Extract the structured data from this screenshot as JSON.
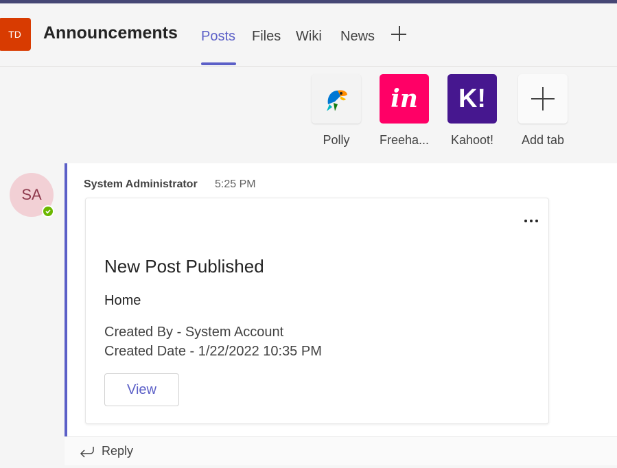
{
  "header": {
    "team_initials": "TD",
    "channel_title": "Announcements",
    "tabs": [
      {
        "label": "Posts"
      },
      {
        "label": "Files"
      },
      {
        "label": "Wiki"
      },
      {
        "label": "News"
      }
    ],
    "active_tab": "Posts"
  },
  "apps": [
    {
      "label": "Polly",
      "icon": "polly-parrot-icon"
    },
    {
      "label": "Freeha...",
      "icon": "invision-freehand-icon",
      "glyph": "in"
    },
    {
      "label": "Kahoot!",
      "icon": "kahoot-icon",
      "glyph": "K!"
    },
    {
      "label": "Add tab",
      "icon": "plus-icon"
    }
  ],
  "message": {
    "author_initials": "SA",
    "author": "System Administrator",
    "time": "5:25 PM",
    "card": {
      "title": "New Post Published",
      "subtitle": "Home",
      "created_by": "Created By - System Account",
      "created_date": "Created Date - 1/22/2022 10:35 PM",
      "button_label": "View"
    },
    "reply_label": "Reply"
  },
  "colors": {
    "accent": "#5b5fc7",
    "team_avatar": "#d83b01",
    "freehand": "#ff0066",
    "kahoot": "#46178f",
    "presence": "#6bb700",
    "user_avatar_bg": "#f2d0d5"
  }
}
